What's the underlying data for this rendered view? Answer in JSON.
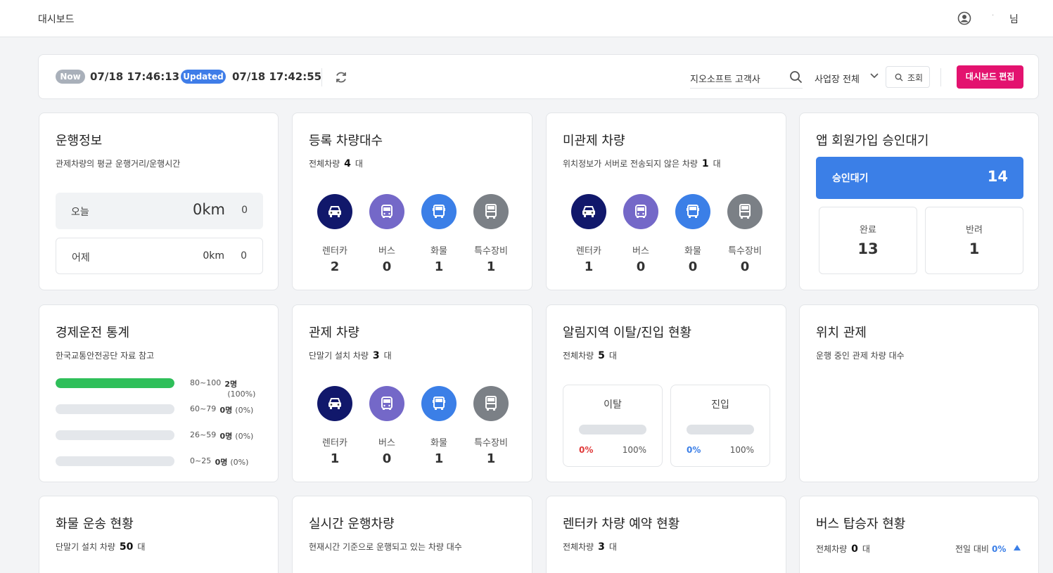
{
  "header": {
    "title": "대시보드",
    "user_name": "·",
    "user_suffix": "님"
  },
  "toolbar": {
    "now_badge": "Now",
    "now_time": "07/18 17:46:13",
    "updated_badge": "Updated",
    "updated_time": "07/18 17:42:55",
    "company": "지오소프트 고객사",
    "site": "사업장 전체",
    "query_label": "조회",
    "edit_label": "대시보드 편집"
  },
  "operation": {
    "title": "운행정보",
    "subtitle": "관제차량의 평균 운행거리/운행시간",
    "today": {
      "label": "오늘",
      "km": "0km",
      "count": "0"
    },
    "yesterday": {
      "label": "어제",
      "km": "0km",
      "count": "0"
    }
  },
  "registered": {
    "title": "등록 차량대수",
    "sub_label": "전체차량",
    "sub_value": "4",
    "sub_unit": "대",
    "items": [
      {
        "label": "렌터카",
        "value": "2",
        "icon": "car-icon",
        "color": "#11186b"
      },
      {
        "label": "버스",
        "value": "0",
        "icon": "bus-icon",
        "color": "#7468c8"
      },
      {
        "label": "화물",
        "value": "1",
        "icon": "truck-icon",
        "color": "#3b7fe7"
      },
      {
        "label": "특수장비",
        "value": "1",
        "icon": "special-vehicle-icon",
        "color": "#7b8086"
      }
    ]
  },
  "uncontrolled": {
    "title": "미관제 차량",
    "sub_label": "위치정보가 서버로 전송되지 않은 차량",
    "sub_value": "1",
    "sub_unit": "대",
    "items": [
      {
        "label": "렌터카",
        "value": "1",
        "icon": "car-icon",
        "color": "#11186b"
      },
      {
        "label": "버스",
        "value": "0",
        "icon": "bus-icon",
        "color": "#7468c8"
      },
      {
        "label": "화물",
        "value": "0",
        "icon": "truck-icon",
        "color": "#3b7fe7"
      },
      {
        "label": "특수장비",
        "value": "0",
        "icon": "special-vehicle-icon",
        "color": "#7b8086"
      }
    ]
  },
  "signup": {
    "title": "앱 회원가입 승인대기",
    "pending_label": "승인대기",
    "pending_value": "14",
    "done_label": "완료",
    "done_value": "13",
    "rejected_label": "반려",
    "rejected_value": "1"
  },
  "eco": {
    "title": "경제운전 통계",
    "subtitle": "한국교통안전공단 자료 참고",
    "rows": [
      {
        "range": "80~100",
        "count": "2명",
        "pct": "(100%)",
        "fill": 1.0
      },
      {
        "range": "60~79",
        "count": "0명",
        "pct": "(0%)",
        "fill": 0
      },
      {
        "range": "26~59",
        "count": "0명",
        "pct": "(0%)",
        "fill": 0
      },
      {
        "range": "0~25",
        "count": "0명",
        "pct": "(0%)",
        "fill": 0
      }
    ]
  },
  "controlled": {
    "title": "관제 차량",
    "sub_label": "단말기 설치 차량",
    "sub_value": "3",
    "sub_unit": "대",
    "items": [
      {
        "label": "렌터카",
        "value": "1",
        "icon": "car-icon",
        "color": "#11186b"
      },
      {
        "label": "버스",
        "value": "0",
        "icon": "bus-icon",
        "color": "#7468c8"
      },
      {
        "label": "화물",
        "value": "1",
        "icon": "truck-icon",
        "color": "#3b7fe7"
      },
      {
        "label": "특수장비",
        "value": "1",
        "icon": "special-vehicle-icon",
        "color": "#7b8086"
      }
    ]
  },
  "zone": {
    "title": "알림지역 이탈/진입 현황",
    "sub_label": "전체차량",
    "sub_value": "5",
    "sub_unit": "대",
    "exit": {
      "label": "이탈",
      "min": "0%",
      "max": "100%",
      "min_color": "#e03a3a"
    },
    "enter": {
      "label": "진입",
      "min": "0%",
      "max": "100%",
      "min_color": "#3b7fe7"
    }
  },
  "location": {
    "title": "위치 관제",
    "subtitle": "운행 중인 관제 차량 대수"
  },
  "cargo": {
    "title": "화물 운송 현황",
    "sub_label": "단말기 설치 차량",
    "sub_value": "50",
    "sub_unit": "대"
  },
  "realtime": {
    "title": "실시간 운행차량",
    "subtitle": "현재시간 기준으로 운행되고 있는 차량 대수"
  },
  "rental": {
    "title": "렌터카 차량 예약 현황",
    "sub_label": "전체차량",
    "sub_value": "3",
    "sub_unit": "대"
  },
  "bus": {
    "title": "버스 탑승자 현황",
    "sub_label": "전체차량",
    "sub_value": "0",
    "sub_unit": "대",
    "compare_label": "전일 대비",
    "compare_value": "0%"
  }
}
